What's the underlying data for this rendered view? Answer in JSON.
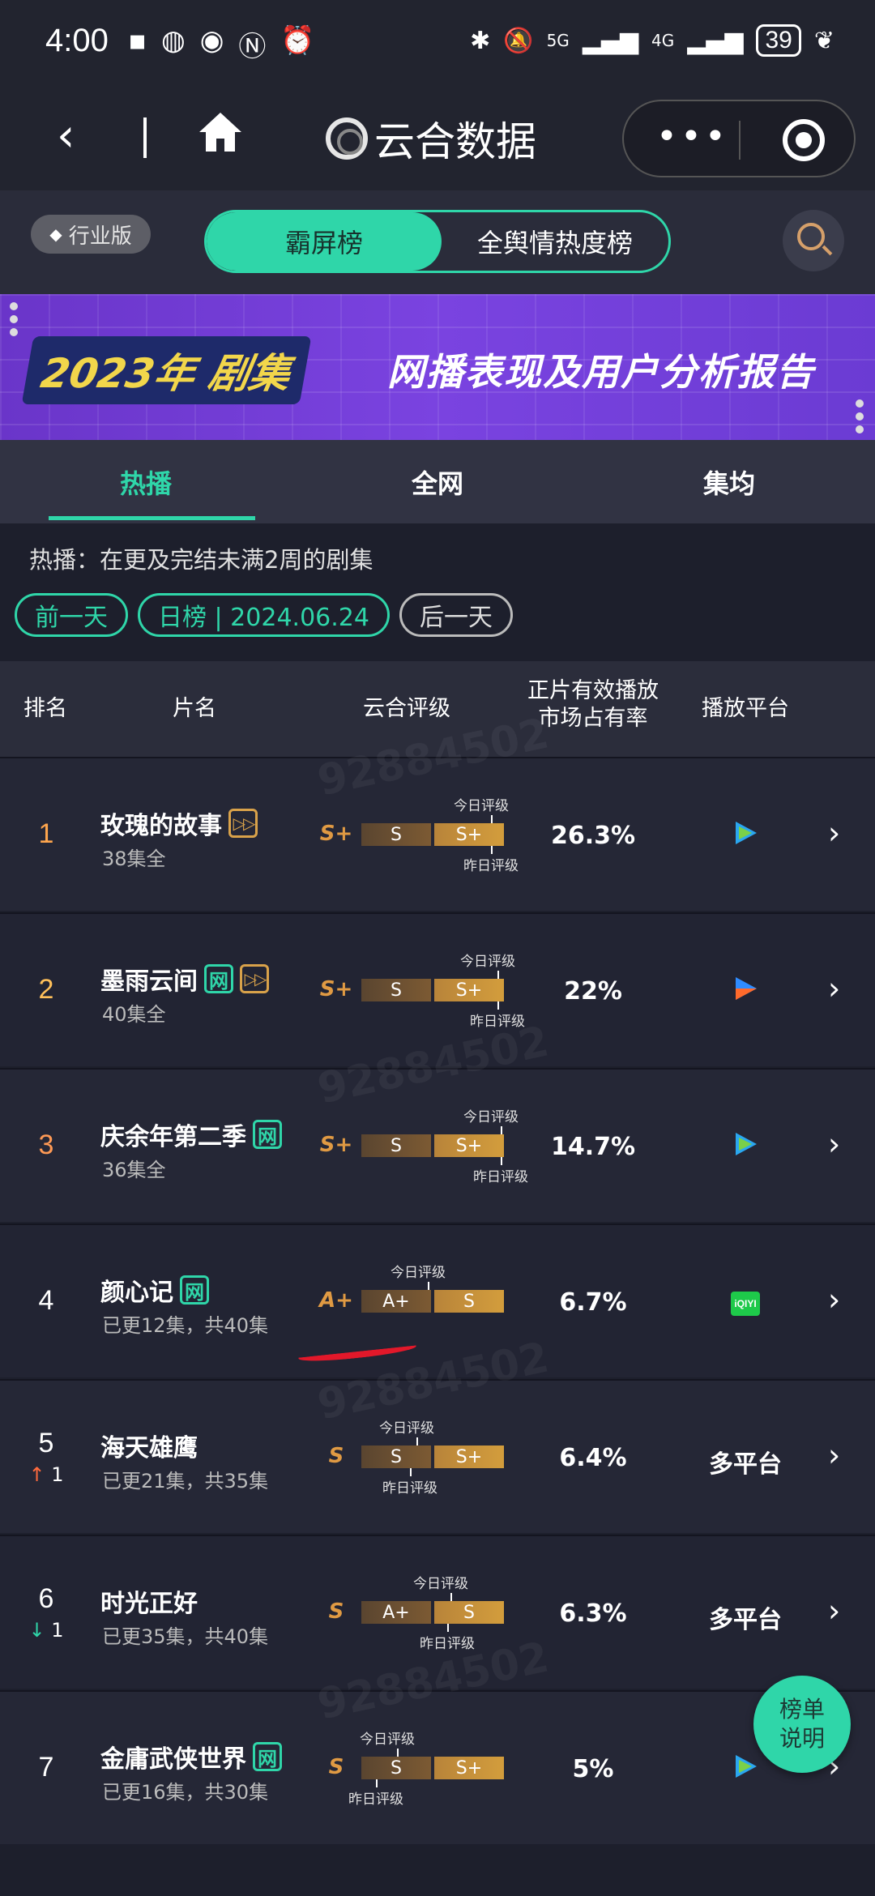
{
  "status_bar": {
    "time": "4:00",
    "network_5g": "5G",
    "network_4g": "4G",
    "battery": "39"
  },
  "nav": {
    "title": "云合数据",
    "more": "•••"
  },
  "top": {
    "industry_label": "行业版",
    "seg_active": "霸屏榜",
    "seg_other": "全舆情热度榜"
  },
  "banner": {
    "year_text": "2023年 剧集",
    "title": "网播表现及用户分析报告"
  },
  "tabs": [
    "热播",
    "全网",
    "集均"
  ],
  "description": "热播：在更及完结未满2周的剧集",
  "date_nav": {
    "prev": "前一天",
    "current": "日榜 | 2024.06.24",
    "next": "后一天"
  },
  "table": {
    "headers": {
      "rank": "排名",
      "title": "片名",
      "rating": "云合评级",
      "share_line1": "正片有效播放",
      "share_line2": "市场占有率",
      "platform": "播放平台"
    },
    "today_label": "今日评级",
    "yesterday_label": "昨日评级",
    "rows": [
      {
        "rank": "1",
        "title": "玫瑰的故事",
        "tags": [
          "ff"
        ],
        "episodes": "38集全",
        "grade": "S+",
        "left": "S",
        "right": "S+",
        "share": "26.3%",
        "platform": "tencent",
        "trend": ""
      },
      {
        "rank": "2",
        "title": "墨雨云间",
        "tags": [
          "网",
          "ff"
        ],
        "episodes": "40集全",
        "grade": "S+",
        "left": "S",
        "right": "S+",
        "share": "22%",
        "platform": "youku",
        "trend": ""
      },
      {
        "rank": "3",
        "title": "庆余年第二季",
        "tags": [
          "网"
        ],
        "episodes": "36集全",
        "grade": "S+",
        "left": "S",
        "right": "S+",
        "share": "14.7%",
        "platform": "tencent",
        "trend": ""
      },
      {
        "rank": "4",
        "title": "颜心记",
        "tags": [
          "网"
        ],
        "episodes": "已更12集，共40集",
        "grade": "A+",
        "left": "A+",
        "right": "S",
        "share": "6.7%",
        "platform": "iqiyi",
        "trend": ""
      },
      {
        "rank": "5",
        "title": "海天雄鹰",
        "tags": [],
        "episodes": "已更21集，共35集",
        "grade": "S",
        "left": "S",
        "right": "S+",
        "share": "6.4%",
        "platform": "多平台",
        "trend": "up",
        "trend_value": "1"
      },
      {
        "rank": "6",
        "title": "时光正好",
        "tags": [],
        "episodes": "已更35集，共40集",
        "grade": "S",
        "left": "A+",
        "right": "S",
        "share": "6.3%",
        "platform": "多平台",
        "trend": "down",
        "trend_value": "1"
      },
      {
        "rank": "7",
        "title": "金庸武侠世界",
        "tags": [
          "网"
        ],
        "episodes": "已更16集，共30集",
        "grade": "S",
        "left": "S",
        "right": "S+",
        "share": "5%",
        "platform": "tencent",
        "trend": ""
      }
    ]
  },
  "float_button": {
    "line1": "榜单",
    "line2": "说明"
  },
  "watermark_text": "92884502",
  "colors": {
    "accent": "#2fd6a9",
    "gold": "#d39d3c",
    "up": "#ff6a3d",
    "down": "#2fd6a9"
  }
}
